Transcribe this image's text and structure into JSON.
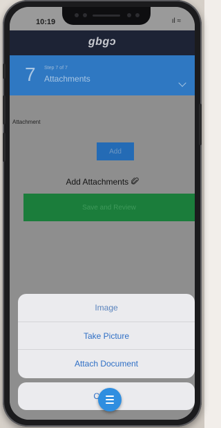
{
  "status": {
    "time": "10:19",
    "signal": "ıl",
    "wifi": "≈"
  },
  "header": {
    "logo": "gbgɔ"
  },
  "step": {
    "number": "7",
    "subtitle": "Step 7 of 7",
    "title": "Attachments",
    "chevron_icon": "chevron-down-icon"
  },
  "form": {
    "attachment_label": "Attachment",
    "add_button": "Add",
    "add_attachments_text": "Add Attachments",
    "paperclip_icon": "paperclip-icon",
    "save_button": "Save and Review"
  },
  "action_sheet": {
    "items": [
      {
        "label": "Image"
      },
      {
        "label": "Take Picture"
      },
      {
        "label": "Attach Document"
      }
    ],
    "cancel_label": "Cancel"
  },
  "fab": {
    "icon": "menu-icon"
  },
  "colors": {
    "header": "#1d2335",
    "step_bar": "#2f78c2",
    "add_button": "#246bb5",
    "save_button": "#1b7d3b",
    "sheet_text": "#2f6fc5",
    "fab": "#2f8ee0"
  }
}
